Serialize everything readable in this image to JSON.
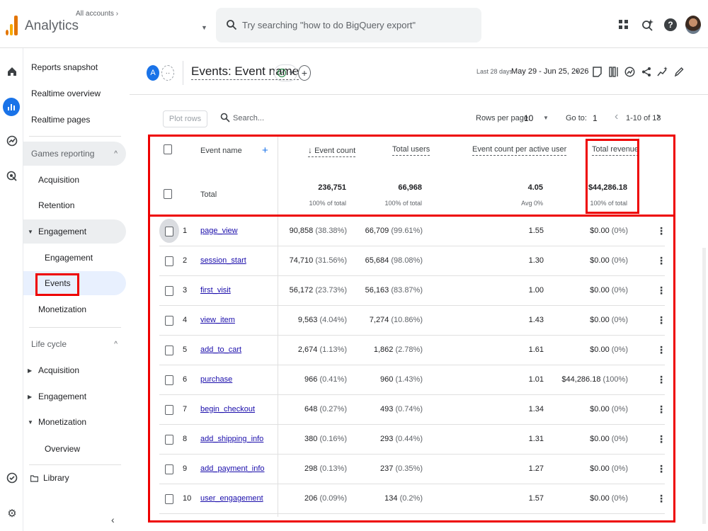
{
  "topbar": {
    "app_title": "Analytics",
    "accounts_label": "All accounts ›",
    "search_placeholder": "Try searching \"how to do BigQuery export\""
  },
  "sidebar": {
    "items": [
      {
        "label": "Reports snapshot"
      },
      {
        "label": "Realtime overview"
      },
      {
        "label": "Realtime pages"
      }
    ],
    "games_reporting": {
      "label": "Games reporting",
      "items": [
        "Acquisition",
        "Retention",
        "Engagement",
        "Engagement",
        "Events",
        "Monetization"
      ]
    },
    "life_cycle": {
      "label": "Life cycle",
      "items": [
        "Acquisition",
        "Engagement",
        "Monetization",
        "Overview"
      ]
    },
    "library": "Library",
    "collapse_icon": "chevron-left-icon"
  },
  "header": {
    "comparison_chip": "A",
    "title": "Events: Event name",
    "date_label": "Last 28 days",
    "date_range": "May 29 - Jun 25, 2026"
  },
  "toolbar": {
    "plot_rows": "Plot rows",
    "search_placeholder": "Search...",
    "rows_per_page_label": "Rows per page:",
    "rows_per_page": "10",
    "goto_label": "Go to:",
    "goto_value": "1",
    "page_range": "1-10 of 13"
  },
  "table": {
    "columns": [
      "Event name",
      "Event count",
      "Total users",
      "Event count per active user",
      "Total revenue"
    ],
    "sort_arrow": "↓",
    "totals": {
      "label": "Total",
      "event_count": "236,751",
      "event_count_sub": "100% of total",
      "total_users": "66,968",
      "total_users_sub": "100% of total",
      "per_user": "4.05",
      "per_user_sub": "Avg 0%",
      "revenue": "$44,286.18",
      "revenue_sub": "100% of total"
    },
    "rows": [
      {
        "idx": "1",
        "event": "page_view",
        "count": "90,858",
        "count_pct": "(38.38%)",
        "users": "66,709",
        "users_pct": "(99.61%)",
        "per_user": "1.55",
        "revenue": "$0.00",
        "revenue_pct": "(0%)"
      },
      {
        "idx": "2",
        "event": "session_start",
        "count": "74,710",
        "count_pct": "(31.56%)",
        "users": "65,684",
        "users_pct": "(98.08%)",
        "per_user": "1.30",
        "revenue": "$0.00",
        "revenue_pct": "(0%)"
      },
      {
        "idx": "3",
        "event": "first_visit",
        "count": "56,172",
        "count_pct": "(23.73%)",
        "users": "56,163",
        "users_pct": "(83.87%)",
        "per_user": "1.00",
        "revenue": "$0.00",
        "revenue_pct": "(0%)"
      },
      {
        "idx": "4",
        "event": "view_item",
        "count": "9,563",
        "count_pct": "(4.04%)",
        "users": "7,274",
        "users_pct": "(10.86%)",
        "per_user": "1.43",
        "revenue": "$0.00",
        "revenue_pct": "(0%)"
      },
      {
        "idx": "5",
        "event": "add_to_cart",
        "count": "2,674",
        "count_pct": "(1.13%)",
        "users": "1,862",
        "users_pct": "(2.78%)",
        "per_user": "1.61",
        "revenue": "$0.00",
        "revenue_pct": "(0%)"
      },
      {
        "idx": "6",
        "event": "purchase",
        "count": "966",
        "count_pct": "(0.41%)",
        "users": "960",
        "users_pct": "(1.43%)",
        "per_user": "1.01",
        "revenue": "$44,286.18",
        "revenue_pct": "(100%)"
      },
      {
        "idx": "7",
        "event": "begin_checkout",
        "count": "648",
        "count_pct": "(0.27%)",
        "users": "493",
        "users_pct": "(0.74%)",
        "per_user": "1.34",
        "revenue": "$0.00",
        "revenue_pct": "(0%)"
      },
      {
        "idx": "8",
        "event": "add_shipping_info",
        "count": "380",
        "count_pct": "(0.16%)",
        "users": "293",
        "users_pct": "(0.44%)",
        "per_user": "1.31",
        "revenue": "$0.00",
        "revenue_pct": "(0%)"
      },
      {
        "idx": "9",
        "event": "add_payment_info",
        "count": "298",
        "count_pct": "(0.13%)",
        "users": "237",
        "users_pct": "(0.35%)",
        "per_user": "1.27",
        "revenue": "$0.00",
        "revenue_pct": "(0%)"
      },
      {
        "idx": "10",
        "event": "user_engagement",
        "count": "206",
        "count_pct": "(0.09%)",
        "users": "134",
        "users_pct": "(0.2%)",
        "per_user": "1.57",
        "revenue": "$0.00",
        "revenue_pct": "(0%)"
      }
    ]
  },
  "colors": {
    "accent": "#1a73e8",
    "highlight_box": "#e00000",
    "link": "#1a0dab"
  }
}
